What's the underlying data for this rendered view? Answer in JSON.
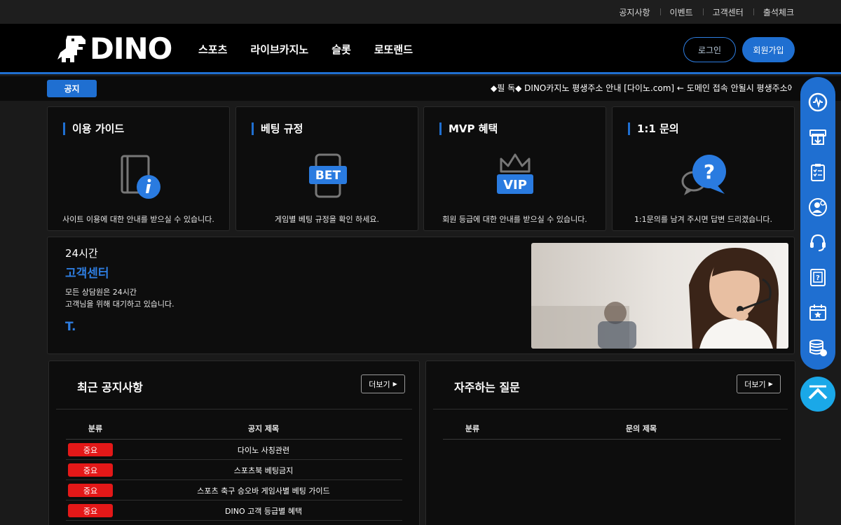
{
  "topbar": {
    "links": [
      "공지사항",
      "이벤트",
      "고객센터",
      "출석체크"
    ]
  },
  "header": {
    "logo_text": "DINO",
    "nav": [
      "스포츠",
      "라이브카지노",
      "슬롯",
      "로또랜드"
    ],
    "login_label": "로그인",
    "join_label": "회원가입",
    "accent_color": "#1f6fd1"
  },
  "notice": {
    "tag": "공지",
    "text": "◆필 독◆ DINO카지노 평생주소 안내 [다이노.com] ← 도메인 접속 안될시 평생주소에서 확인하세요"
  },
  "cards": [
    {
      "title": "이용 가이드",
      "icon": "guide-book-info-icon",
      "desc": "사이트 이용에 대한 안내를 받으실 수 있습니다."
    },
    {
      "title": "베팅 규정",
      "icon": "bet-phone-icon",
      "icon_text": "BET",
      "desc": "게임별 베팅 규정을 확인 하세요."
    },
    {
      "title": "MVP 혜택",
      "icon": "vip-crown-icon",
      "icon_text": "VIP",
      "desc": "회원 등급에 대한 안내를 받으실 수 있습니다."
    },
    {
      "title": "1:1 문의",
      "icon": "chat-question-icon",
      "icon_text": "?",
      "desc": "1:1문의를 남겨 주시면 답변 드리겠습니다."
    }
  ],
  "support": {
    "hours": "24시간",
    "title": "고객센터",
    "line1": "모든 상담원은 24시간",
    "line2": "고객님을 위해 대기하고 있습니다.",
    "tel": "T.",
    "photo": "customer-service-agent-photo"
  },
  "notices_board": {
    "title": "최근 공지사항",
    "more": "더보기",
    "col_category": "분류",
    "col_title": "공지 제목",
    "rows": [
      {
        "badge": "중요",
        "title": "다이노 사칭관련"
      },
      {
        "badge": "중요",
        "title": "스포츠북 베팅금지"
      },
      {
        "badge": "중요",
        "title": "스포츠 축구 승오바 게임사별 베팅 가이드"
      },
      {
        "badge": "중요",
        "title": "DINO 고객 등급별 혜택"
      }
    ]
  },
  "faq_board": {
    "title": "자주하는 질문",
    "more": "더보기",
    "col_category": "분류",
    "col_title": "문의 제목"
  },
  "quick_menu": [
    "wallet-icon",
    "withdraw-icon",
    "checklist-icon",
    "user-settings-icon",
    "headset-icon",
    "guide-book-icon",
    "calendar-star-icon",
    "coins-icon"
  ],
  "scroll_top_icon": "chevron-up-icon"
}
